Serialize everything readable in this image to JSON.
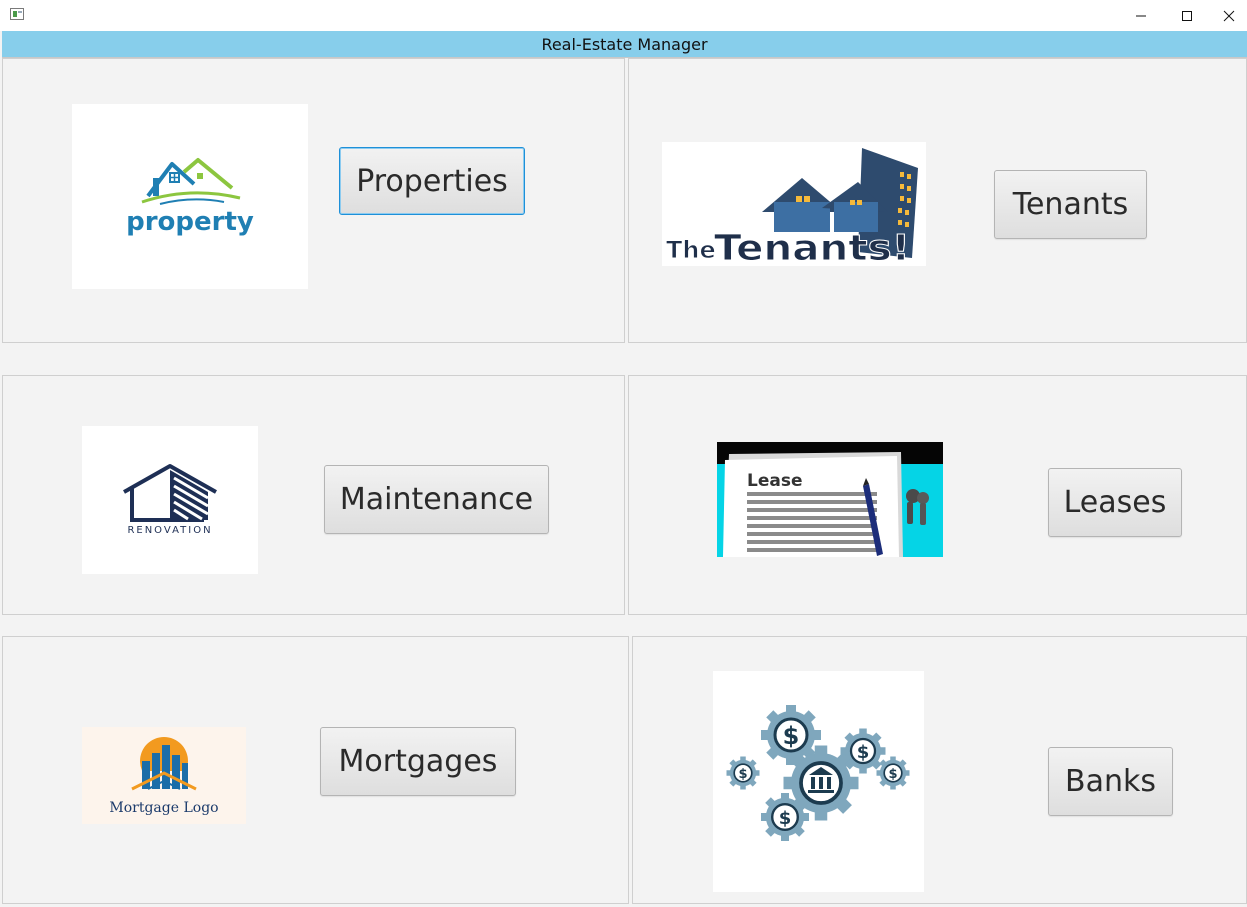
{
  "window": {
    "title": "Real-Estate Manager"
  },
  "cards": {
    "properties": {
      "button": "Properties",
      "logo_text": "property"
    },
    "tenants": {
      "button": "Tenants",
      "logo_text_a": "The",
      "logo_text_b": "Tenants!"
    },
    "maintenance": {
      "button": "Maintenance",
      "logo_text": "RENOVATION"
    },
    "leases": {
      "button": "Leases",
      "logo_text": "Lease"
    },
    "mortgages": {
      "button": "Mortgages",
      "logo_text": "Mortgage Logo"
    },
    "banks": {
      "button": "Banks"
    }
  },
  "colors": {
    "header_bg": "#87ceeb",
    "focus_ring": "#1e90d8"
  }
}
